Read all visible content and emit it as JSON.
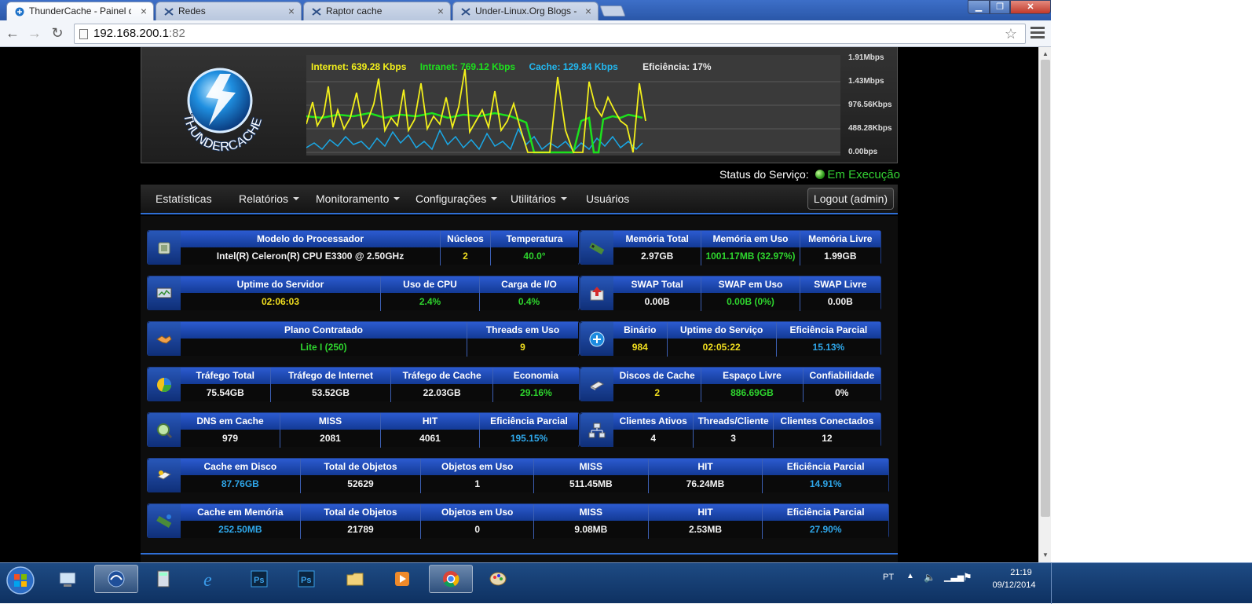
{
  "browser": {
    "tabs": [
      {
        "title": "ThunderCache - Painel de",
        "active": true
      },
      {
        "title": "Redes",
        "active": false
      },
      {
        "title": "Raptor cache",
        "active": false
      },
      {
        "title": "Under-Linux.Org Blogs - r",
        "active": false
      }
    ],
    "address": {
      "host": "192.168.200.1",
      "port": ":82"
    }
  },
  "header": {
    "logo_text": "THUNDERCACHE",
    "legend": {
      "internet": "Internet: 639.28 Kbps",
      "intranet": "Intranet: 769.12 Kbps",
      "cache": "Cache: 129.84 Kbps",
      "efficiency": "Eficiência: 17%"
    },
    "y_ticks": [
      "1.91Mbps",
      "1.43Mbps",
      "976.56Kbps",
      "488.28Kbps",
      "0.00bps"
    ]
  },
  "status": {
    "label": "Status do Serviço:",
    "value": "Em Execução"
  },
  "nav": {
    "items": [
      {
        "label": "Estatísticas",
        "dropdown": false
      },
      {
        "label": "Relatórios",
        "dropdown": true
      },
      {
        "label": "Monitoramento",
        "dropdown": true
      },
      {
        "label": "Configurações",
        "dropdown": true
      },
      {
        "label": "Utilitários",
        "dropdown": true
      },
      {
        "label": "Usuários",
        "dropdown": false
      }
    ],
    "logout": "Logout (admin)"
  },
  "blocks": [
    {
      "icon": "cpu-icon",
      "cols": [
        {
          "h": "Modelo do Processador",
          "v": "Intel(R) Celeron(R) CPU E3300 @ 2.50GHz",
          "c": "white"
        },
        {
          "h": "Núcleos",
          "v": "2",
          "c": "yellow"
        },
        {
          "h": "Temperatura",
          "v": "40.0°",
          "c": "green"
        }
      ]
    },
    {
      "icon": "memory-icon",
      "cols": [
        {
          "h": "Memória Total",
          "v": "2.97GB",
          "c": "white"
        },
        {
          "h": "Memória em Uso",
          "v": "1001.17MB (32.97%)",
          "c": "green"
        },
        {
          "h": "Memória Livre",
          "v": "1.99GB",
          "c": "white"
        }
      ]
    },
    {
      "icon": "monitor-icon",
      "cols": [
        {
          "h": "Uptime do Servidor",
          "v": "02:06:03",
          "c": "yellow"
        },
        {
          "h": "Uso de CPU",
          "v": "2.4%",
          "c": "green"
        },
        {
          "h": "Carga de I/O",
          "v": "0.4%",
          "c": "green"
        }
      ]
    },
    {
      "icon": "swap-icon",
      "cols": [
        {
          "h": "SWAP Total",
          "v": "0.00B",
          "c": "white"
        },
        {
          "h": "SWAP em Uso",
          "v": "0.00B (0%)",
          "c": "green"
        },
        {
          "h": "SWAP Livre",
          "v": "0.00B",
          "c": "white"
        }
      ]
    },
    {
      "icon": "handshake-icon",
      "cols": [
        {
          "h": "Plano Contratado",
          "v": "Lite I (250)",
          "c": "green"
        },
        {
          "h": "Threads em Uso",
          "v": "9",
          "c": "yellow"
        }
      ]
    },
    {
      "icon": "binary-icon",
      "cols": [
        {
          "h": "Binário",
          "v": "984",
          "c": "yellow"
        },
        {
          "h": "Uptime do Serviço",
          "v": "02:05:22",
          "c": "yellow"
        },
        {
          "h": "Eficiência Parcial",
          "v": "15.13%",
          "c": "blue"
        }
      ]
    },
    {
      "icon": "pie-chart-icon",
      "cols": [
        {
          "h": "Tráfego Total",
          "v": "75.54GB",
          "c": "white"
        },
        {
          "h": "Tráfego de Internet",
          "v": "53.52GB",
          "c": "white"
        },
        {
          "h": "Tráfego de Cache",
          "v": "22.03GB",
          "c": "white"
        },
        {
          "h": "Economia",
          "v": "29.16%",
          "c": "green"
        }
      ]
    },
    {
      "icon": "disk-icon",
      "cols": [
        {
          "h": "Discos de Cache",
          "v": "2",
          "c": "yellow"
        },
        {
          "h": "Espaço Livre",
          "v": "886.69GB",
          "c": "green"
        },
        {
          "h": "Confiabilidade",
          "v": "0%",
          "c": "white"
        }
      ]
    },
    {
      "icon": "dns-icon",
      "cols": [
        {
          "h": "DNS em Cache",
          "v": "979",
          "c": "white"
        },
        {
          "h": "MISS",
          "v": "2081",
          "c": "white"
        },
        {
          "h": "HIT",
          "v": "4061",
          "c": "white"
        },
        {
          "h": "Eficiência Parcial",
          "v": "195.15%",
          "c": "blue"
        }
      ]
    },
    {
      "icon": "network-icon",
      "cols": [
        {
          "h": "Clientes Ativos",
          "v": "4",
          "c": "white"
        },
        {
          "h": "Threads/Cliente",
          "v": "3",
          "c": "white"
        },
        {
          "h": "Clientes Conectados",
          "v": "12",
          "c": "white"
        }
      ]
    },
    {
      "icon": "disk-cache-icon",
      "cols": [
        {
          "h": "Cache em Disco",
          "v": "87.76GB",
          "c": "blue"
        },
        {
          "h": "Total de Objetos",
          "v": "52629",
          "c": "white"
        },
        {
          "h": "Objetos em Uso",
          "v": "1",
          "c": "white"
        },
        {
          "h": "MISS",
          "v": "511.45MB",
          "c": "white"
        },
        {
          "h": "HIT",
          "v": "76.24MB",
          "c": "white"
        },
        {
          "h": "Eficiência Parcial",
          "v": "14.91%",
          "c": "blue"
        }
      ]
    },
    {
      "icon": "memory-cache-icon",
      "cols": [
        {
          "h": "Cache em Memória",
          "v": "252.50MB",
          "c": "blue"
        },
        {
          "h": "Total de Objetos",
          "v": "21789",
          "c": "white"
        },
        {
          "h": "Objetos em Uso",
          "v": "0",
          "c": "white"
        },
        {
          "h": "MISS",
          "v": "9.08MB",
          "c": "white"
        },
        {
          "h": "HIT",
          "v": "2.53MB",
          "c": "white"
        },
        {
          "h": "Eficiência Parcial",
          "v": "27.90%",
          "c": "blue"
        }
      ]
    }
  ],
  "taskbar": {
    "apps": [
      "remote-desktop-icon",
      "thunderbird-icon",
      "calculator-icon",
      "internet-explorer-icon",
      "photoshop-icon",
      "photoshop-icon",
      "folder-icon",
      "media-player-icon",
      "chrome-icon",
      "paint-icon"
    ],
    "language": "PT",
    "time": "21:19",
    "date": "09/12/2014"
  },
  "colors": {
    "internet": "#f2ef1b",
    "intranet": "#1de11d",
    "cache": "#22b7ef",
    "accent": "#2f6fd6"
  }
}
